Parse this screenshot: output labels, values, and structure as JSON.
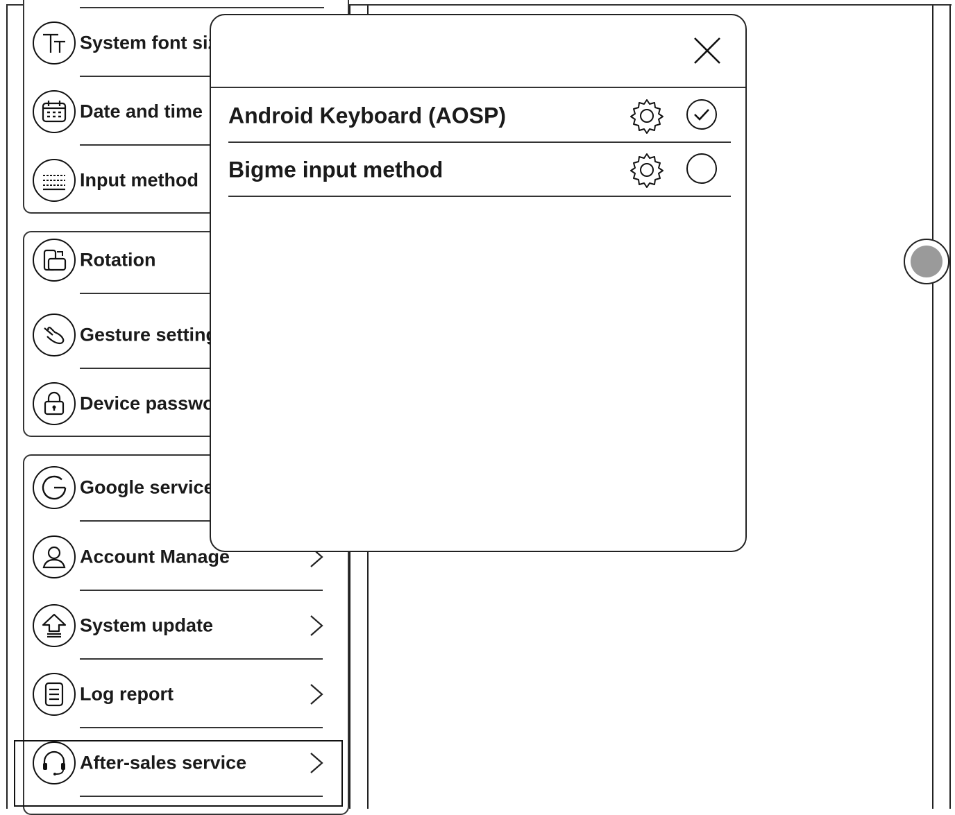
{
  "settings": {
    "group1": [
      {
        "label": "System font size",
        "icon": "font-size-icon"
      },
      {
        "label": "Date and time",
        "icon": "calendar-icon"
      },
      {
        "label": "Input method",
        "icon": "keyboard-icon"
      }
    ],
    "group2": [
      {
        "label": "Rotation",
        "icon": "rotation-icon"
      },
      {
        "label": "Gesture settings",
        "icon": "gesture-icon"
      },
      {
        "label": "Device password",
        "icon": "lock-icon"
      }
    ],
    "group3": [
      {
        "label": "Google service",
        "icon": "google-icon"
      },
      {
        "label": "Account Manage",
        "icon": "account-icon"
      },
      {
        "label": "System update",
        "icon": "update-icon"
      },
      {
        "label": "Log report",
        "icon": "document-icon"
      },
      {
        "label": "After-sales service",
        "icon": "headset-icon"
      }
    ]
  },
  "dialog": {
    "options": [
      {
        "label": "Android Keyboard (AOSP)",
        "selected": true
      },
      {
        "label": "Bigme input method",
        "selected": false
      }
    ]
  },
  "colors": {
    "knob_fill": "#9a9a9a",
    "stroke": "#222222"
  }
}
